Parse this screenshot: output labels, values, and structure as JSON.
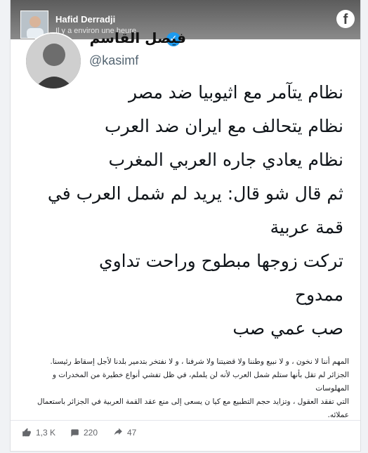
{
  "post": {
    "author": "Hafid Derradji",
    "timestamp": "Il y a environ une heure",
    "platform_icon": "facebook-icon"
  },
  "tweet": {
    "name": "فيصل القاسم",
    "handle": "@kasimf",
    "lines": [
      "نظام يتآمر مع اثيوبيا ضد مصر",
      "نظام يتحالف مع ايران ضد العرب",
      "نظام يعادي جاره العربي المغرب",
      "ثم قال شو قال: يريد لم شمل العرب في",
      "قمة عربية",
      "تركت زوجها مبطوح وراحت تداوي",
      "ممدوح",
      "صب عمي صب"
    ]
  },
  "caption": {
    "lines": [
      "المهم أننا لا نخون ، و لا نبيع وطننا ولا قضيتنا ولا شرفنا ، و لا نفتخر بتدمير بلدنا لأجل إسقاط رئيسنا.",
      "الجزائر لم تقل بأنها ستلم شمل العرب لأنه لن يلملم، في ظل تفشي أنواع خطيرة من المخدرات و المهلوسات",
      "التي تفقد العقول ، وتزايد حجم التطبيع مع كيا ن يسعى إلى منع عقد القمة العربية في الجزائر باستعمال",
      "عملائه."
    ]
  },
  "stats": {
    "likes": "1,3 K",
    "comments": "220",
    "shares": "47"
  },
  "colors": {
    "verified": "#1d9bf0",
    "card_bg": "#ffffff",
    "page_bg": "#f0f2f5"
  }
}
